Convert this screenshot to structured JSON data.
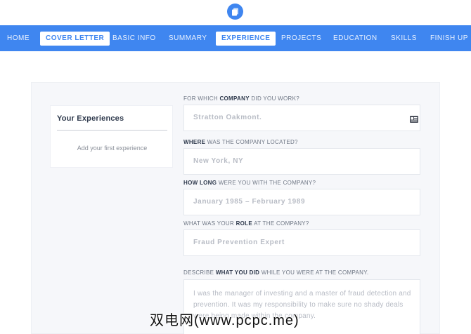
{
  "logo": {
    "icon": "document-icon",
    "color": "#3f86f0"
  },
  "nav": {
    "items": [
      {
        "label": "HOME"
      },
      {
        "label": "COVER LETTER"
      },
      {
        "label": "BASIC INFO"
      },
      {
        "label": "SUMMARY"
      },
      {
        "label": "EXPERIENCE"
      },
      {
        "label": "PROJECTS"
      },
      {
        "label": "EDUCATION"
      },
      {
        "label": "SKILLS"
      },
      {
        "label": "FINISH UP"
      }
    ],
    "active": "EXPERIENCE",
    "highlighted": [
      "COVER LETTER",
      "EXPERIENCE"
    ],
    "background": "#3f86f0"
  },
  "sidebar": {
    "title": "Your Experiences",
    "empty_text": "Add your first experience"
  },
  "form": {
    "company": {
      "q_pre": "FOR WHICH ",
      "q_bold": "COMPANY",
      "q_post": " DID YOU WORK?",
      "placeholder": "Stratton Oakmont.",
      "icon": "contact-card-icon"
    },
    "location": {
      "q_bold": "WHERE",
      "q_post": " WAS THE COMPANY LOCATED?",
      "placeholder": "New York, NY"
    },
    "duration": {
      "q_bold": "HOW LONG",
      "q_post": " WERE YOU WITH THE COMPANY?",
      "placeholder": "January 1985 – February 1989"
    },
    "role": {
      "q_pre": "WHAT WAS YOUR ",
      "q_bold": "ROLE",
      "q_post": " AT THE COMPANY?",
      "placeholder": "Fraud Prevention Expert"
    },
    "description": {
      "q_pre": "DESCRIBE ",
      "q_bold": "WHAT YOU DID",
      "q_post": " WHILE YOU WERE AT THE COMPANY.",
      "placeholder": "I was the manager of investing and a master of fraud detection and prevention. It was my responsibility to make sure no shady deals were being made within the company."
    }
  },
  "watermark": "双电网(www.pcpc.me)"
}
